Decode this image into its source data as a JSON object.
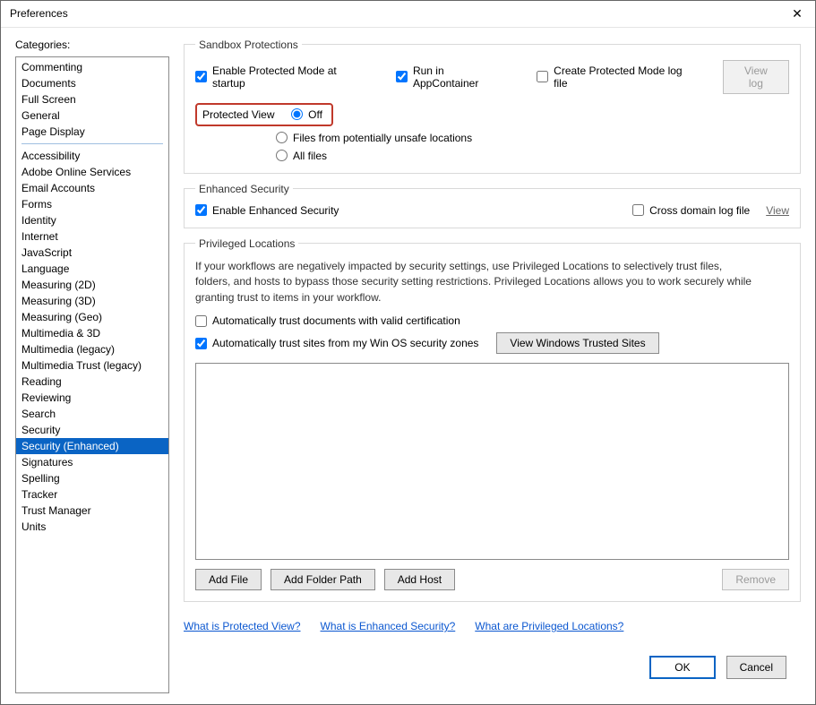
{
  "window": {
    "title": "Preferences"
  },
  "sidebar": {
    "label": "Categories:",
    "groups": [
      [
        "Commenting",
        "Documents",
        "Full Screen",
        "General",
        "Page Display"
      ],
      [
        "Accessibility",
        "Adobe Online Services",
        "Email Accounts",
        "Forms",
        "Identity",
        "Internet",
        "JavaScript",
        "Language",
        "Measuring (2D)",
        "Measuring (3D)",
        "Measuring (Geo)",
        "Multimedia & 3D",
        "Multimedia (legacy)",
        "Multimedia Trust (legacy)",
        "Reading",
        "Reviewing",
        "Search",
        "Security",
        "Security (Enhanced)",
        "Signatures",
        "Spelling",
        "Tracker",
        "Trust Manager",
        "Units"
      ]
    ],
    "selected": "Security (Enhanced)"
  },
  "sandbox": {
    "legend": "Sandbox Protections",
    "enable_pm": "Enable Protected Mode at startup",
    "run_appc": "Run in AppContainer",
    "create_log": "Create Protected Mode log file",
    "view_log_btn": "View log",
    "pv_label": "Protected View",
    "pv_off": "Off",
    "pv_unsafe": "Files from potentially unsafe locations",
    "pv_all": "All files"
  },
  "enhsec": {
    "legend": "Enhanced Security",
    "enable": "Enable Enhanced Security",
    "crosslog": "Cross domain log file",
    "view": "View"
  },
  "priv": {
    "legend": "Privileged Locations",
    "help": "If your workflows are negatively impacted by security settings, use Privileged Locations to selectively trust files, folders, and hosts to bypass those security setting restrictions. Privileged Locations allows you to work securely while granting trust to items in your workflow.",
    "auto_cert": "Automatically trust documents with valid certification",
    "auto_sites": "Automatically trust sites from my Win OS security zones",
    "view_trusted_btn": "View Windows Trusted Sites",
    "add_file": "Add File",
    "add_folder": "Add Folder Path",
    "add_host": "Add Host",
    "remove": "Remove"
  },
  "links": {
    "pv": "What is Protected View?",
    "es": "What is Enhanced Security?",
    "pl": "What are Privileged Locations?"
  },
  "buttons": {
    "ok": "OK",
    "cancel": "Cancel"
  }
}
